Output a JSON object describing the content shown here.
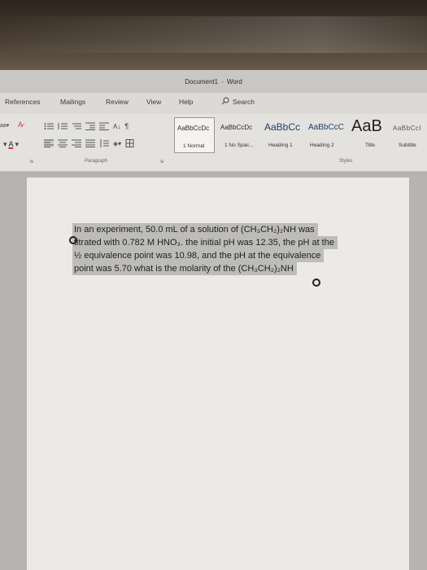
{
  "window": {
    "document_name": "Document1",
    "separator": "-",
    "app_name": "Word"
  },
  "tabs": [
    "References",
    "Mailings",
    "Review",
    "View",
    "Help"
  ],
  "search": {
    "label": "Search",
    "icon": "search-icon"
  },
  "ribbon": {
    "paragraph_label": "Paragraph",
    "styles_label": "Styles",
    "styles": [
      {
        "sample": "AaBbCcDc",
        "name": "1 Normal",
        "selected": true
      },
      {
        "sample": "AaBbCcDc",
        "name": "1 No Spac..."
      },
      {
        "sample": "AaBbCc",
        "name": "Heading 1"
      },
      {
        "sample": "AaBbCcC",
        "name": "Heading 2"
      },
      {
        "sample": "AaB",
        "name": "Title"
      },
      {
        "sample": "AaBbCcI",
        "name": "Subtitle"
      }
    ],
    "font_color_label": "A",
    "font_color": "#d0312d"
  },
  "document": {
    "lines": [
      "In an experiment, 50.0 mL of a solution of (CH₃CH₂)₂NH was",
      "titrated with 0.782 M HNO₃. the initial pH was 12.35, the pH at the",
      "½ equivalence point was 10.98, and the pH at the equivalence",
      "point was 5.70 what is the molarity of the (CH₃CH₂)₂NH"
    ]
  }
}
